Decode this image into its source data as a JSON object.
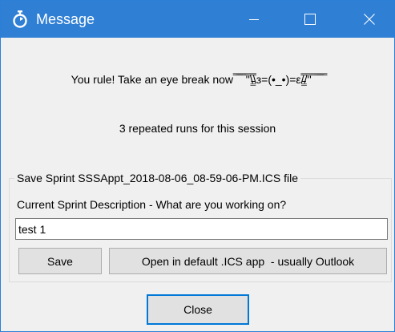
{
  "window": {
    "title": "Message",
    "titlebar_color": "#2f7fd5",
    "icons": {
      "app": "stopwatch-icon",
      "minimize": "minimize-icon",
      "maximize": "maximize-icon",
      "close": "close-icon"
    }
  },
  "content": {
    "message": "You rule! Take an eye break now ̿̿ ̿̿ ̿̿ ̿'̿'\\̵͇̿̿\\з=(•_•)=ε/̵͇̿̿/'̿'̿ ̿ ̿̿ ̿̿ ̿̿",
    "runs_info": "3 repeated runs for this session"
  },
  "save_group": {
    "legend": "Save Sprint SSSAppt_2018-08-06_08-59-06-PM.ICS file",
    "field_label": "Current Sprint Description - What are you working on?",
    "description_value": "test 1",
    "save_label": "Save",
    "open_label": "Open in default .ICS app  - usually Outlook"
  },
  "footer": {
    "close_label": "Close",
    "focus_color": "#0078d7"
  }
}
